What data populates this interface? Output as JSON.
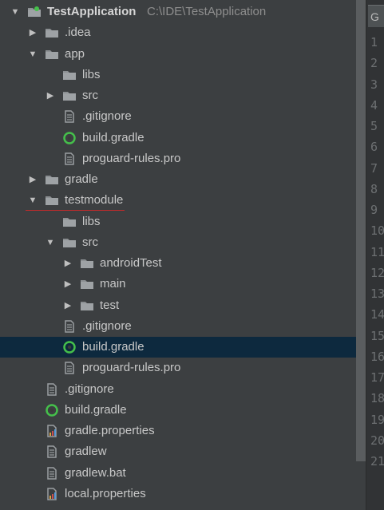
{
  "colors": {
    "background": "#3c3f41",
    "selection": "#0d293e",
    "text": "#c8c8c8",
    "path_text": "#8e8e8e",
    "folder": "#8b8f92",
    "gradle_icon": "#45bf4b",
    "underline": "#c62a2a",
    "gutter": "#313335",
    "line_numbers": "#6d7072"
  },
  "tree": [
    {
      "label": "TestApplication",
      "path": "C:\\IDE\\TestApplication",
      "icon": "project-folder-icon",
      "arrow": "expanded",
      "root": true
    },
    {
      "label": ".idea",
      "icon": "folder-icon",
      "arrow": "collapsed"
    },
    {
      "label": "app",
      "icon": "folder-icon",
      "arrow": "expanded"
    },
    {
      "label": "libs",
      "icon": "folder-icon",
      "arrow": "none"
    },
    {
      "label": "src",
      "icon": "folder-icon",
      "arrow": "collapsed"
    },
    {
      "label": ".gitignore",
      "icon": "text-file-icon",
      "arrow": "none"
    },
    {
      "label": "build.gradle",
      "icon": "gradle-icon",
      "arrow": "none"
    },
    {
      "label": "proguard-rules.pro",
      "icon": "text-file-icon",
      "arrow": "none"
    },
    {
      "label": "gradle",
      "icon": "folder-icon",
      "arrow": "collapsed"
    },
    {
      "label": "testmodule",
      "icon": "folder-icon",
      "arrow": "expanded",
      "underlined": true
    },
    {
      "label": "libs",
      "icon": "folder-icon",
      "arrow": "none"
    },
    {
      "label": "src",
      "icon": "folder-icon",
      "arrow": "expanded"
    },
    {
      "label": "androidTest",
      "icon": "folder-icon",
      "arrow": "collapsed"
    },
    {
      "label": "main",
      "icon": "folder-icon",
      "arrow": "collapsed"
    },
    {
      "label": "test",
      "icon": "folder-icon",
      "arrow": "collapsed"
    },
    {
      "label": ".gitignore",
      "icon": "text-file-icon",
      "arrow": "none"
    },
    {
      "label": "build.gradle",
      "icon": "gradle-icon",
      "arrow": "none",
      "selected": true
    },
    {
      "label": "proguard-rules.pro",
      "icon": "text-file-icon",
      "arrow": "none"
    },
    {
      "label": ".gitignore",
      "icon": "text-file-icon",
      "arrow": "none"
    },
    {
      "label": "build.gradle",
      "icon": "gradle-icon",
      "arrow": "none"
    },
    {
      "label": "gradle.properties",
      "icon": "properties-file-icon",
      "arrow": "none"
    },
    {
      "label": "gradlew",
      "icon": "text-file-icon",
      "arrow": "none"
    },
    {
      "label": "gradlew.bat",
      "icon": "text-file-icon",
      "arrow": "none"
    },
    {
      "label": "local.properties",
      "icon": "properties-file-icon",
      "arrow": "none"
    }
  ],
  "editor": {
    "tab_label": "G",
    "line_numbers": [
      "1",
      "2",
      "3",
      "4",
      "5",
      "6",
      "7",
      "8",
      "9",
      "10",
      "11",
      "12",
      "13",
      "14",
      "15",
      "16",
      "17",
      "18",
      "19",
      "20",
      "21"
    ]
  }
}
